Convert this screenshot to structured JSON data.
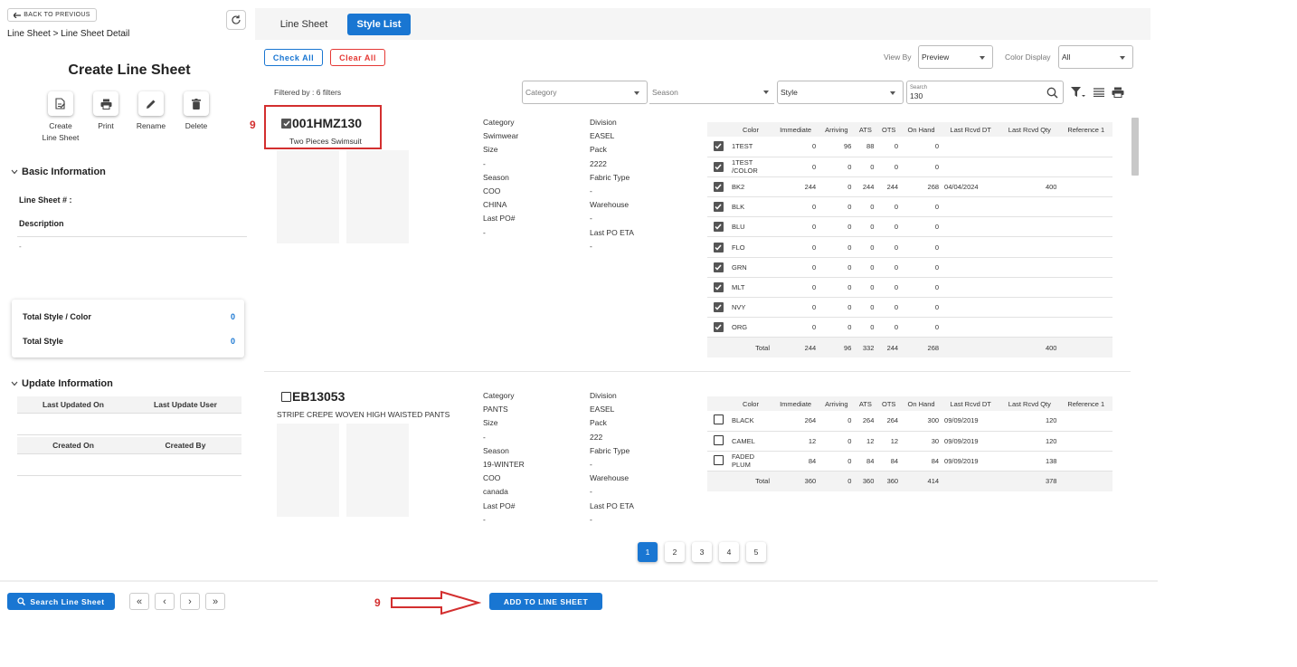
{
  "nav": {
    "back_label": "BACK TO PREVIOUS",
    "breadcrumb": "Line Sheet > Line Sheet Detail"
  },
  "page_title": "Create Line Sheet",
  "actions": [
    {
      "label_line1": "Create",
      "label_line2": "Line Sheet",
      "icon": "create-line-sheet-icon"
    },
    {
      "label_line1": "Print",
      "label_line2": "",
      "icon": "print-icon"
    },
    {
      "label_line1": "Rename",
      "label_line2": "",
      "icon": "pencil-icon"
    },
    {
      "label_line1": "Delete",
      "label_line2": "",
      "icon": "trash-icon"
    }
  ],
  "basic_info": {
    "heading": "Basic Information",
    "line_sheet_label": "Line Sheet # :",
    "description_label": "Description",
    "description_value": "-"
  },
  "totals": {
    "style_color_label": "Total Style / Color",
    "style_color_value": "0",
    "style_label": "Total Style",
    "style_value": "0"
  },
  "update_info": {
    "heading": "Update Information",
    "col1": "Last Updated On",
    "col2": "Last Update User",
    "col3": "Created On",
    "col4": "Created By"
  },
  "tabs": [
    {
      "label": "Line Sheet",
      "active": false
    },
    {
      "label": "Style List",
      "active": true
    }
  ],
  "toolbar": {
    "check_all": "Check All",
    "clear_all": "Clear All",
    "view_by_label": "View By",
    "view_by_value": "Preview",
    "color_display_label": "Color Display",
    "color_display_value": "All"
  },
  "filters": {
    "filtered_by": "Filtered by :  6 filters",
    "category": "Category",
    "season": "Season",
    "style": "Style",
    "search_label": "Search",
    "search_value": "130"
  },
  "headers": [
    "Color",
    "Immediate",
    "Arriving",
    "ATS",
    "OTS",
    "On Hand",
    "Last Rcvd DT",
    "Last Rcvd Qty",
    "Reference 1"
  ],
  "styles": [
    {
      "code": "001HMZ130",
      "checked": true,
      "desc": "Two Pieces Swimsuit",
      "attrs_left": [
        "Category",
        "Swimwear",
        "Size",
        "-",
        "Season",
        "COO",
        "CHINA",
        "Last PO#",
        "-"
      ],
      "attrs_right": [
        "Division",
        "EASEL",
        "Pack",
        "2222",
        "Fabric Type",
        "-",
        "Warehouse",
        "-",
        "Last PO ETA",
        "-"
      ],
      "rows": [
        {
          "color": "1TEST",
          "immediate": "0",
          "arriving": "96",
          "ats": "88",
          "ots": "0",
          "onhand": "0",
          "dt": "",
          "qty": "",
          "ref": "",
          "checked": true
        },
        {
          "color": "1TEST /COLOR",
          "immediate": "0",
          "arriving": "0",
          "ats": "0",
          "ots": "0",
          "onhand": "0",
          "dt": "",
          "qty": "",
          "ref": "",
          "checked": true
        },
        {
          "color": "BK2",
          "immediate": "244",
          "arriving": "0",
          "ats": "244",
          "ots": "244",
          "onhand": "268",
          "dt": "04/04/2024",
          "qty": "400",
          "ref": "",
          "checked": true
        },
        {
          "color": "BLK",
          "immediate": "0",
          "arriving": "0",
          "ats": "0",
          "ots": "0",
          "onhand": "0",
          "dt": "",
          "qty": "",
          "ref": "",
          "checked": true
        },
        {
          "color": "BLU",
          "immediate": "0",
          "arriving": "0",
          "ats": "0",
          "ots": "0",
          "onhand": "0",
          "dt": "",
          "qty": "",
          "ref": "",
          "checked": true
        },
        {
          "color": "FLO",
          "immediate": "0",
          "arriving": "0",
          "ats": "0",
          "ots": "0",
          "onhand": "0",
          "dt": "",
          "qty": "",
          "ref": "",
          "checked": true
        },
        {
          "color": "GRN",
          "immediate": "0",
          "arriving": "0",
          "ats": "0",
          "ots": "0",
          "onhand": "0",
          "dt": "",
          "qty": "",
          "ref": "",
          "checked": true
        },
        {
          "color": "MLT",
          "immediate": "0",
          "arriving": "0",
          "ats": "0",
          "ots": "0",
          "onhand": "0",
          "dt": "",
          "qty": "",
          "ref": "",
          "checked": true
        },
        {
          "color": "NVY",
          "immediate": "0",
          "arriving": "0",
          "ats": "0",
          "ots": "0",
          "onhand": "0",
          "dt": "",
          "qty": "",
          "ref": "",
          "checked": true
        },
        {
          "color": "ORG",
          "immediate": "0",
          "arriving": "0",
          "ats": "0",
          "ots": "0",
          "onhand": "0",
          "dt": "",
          "qty": "",
          "ref": "",
          "checked": true
        }
      ],
      "total": {
        "label": "Total",
        "immediate": "244",
        "arriving": "96",
        "ats": "332",
        "ots": "244",
        "onhand": "268",
        "dt": "",
        "qty": "400",
        "ref": ""
      }
    },
    {
      "code": "EB13053",
      "checked": false,
      "desc": "STRIPE CREPE WOVEN HIGH WAISTED PANTS",
      "attrs_left": [
        "Category",
        "PANTS",
        "Size",
        "-",
        "Season",
        "19-WINTER",
        "COO",
        "canada",
        "Last PO#",
        "-"
      ],
      "attrs_right": [
        "Division",
        "EASEL",
        "Pack",
        "222",
        "Fabric Type",
        "-",
        "Warehouse",
        "-",
        "Last PO ETA",
        "-"
      ],
      "rows": [
        {
          "color": "BLACK",
          "immediate": "264",
          "arriving": "0",
          "ats": "264",
          "ots": "264",
          "onhand": "300",
          "dt": "09/09/2019",
          "qty": "120",
          "ref": "",
          "checked": false
        },
        {
          "color": "CAMEL",
          "immediate": "12",
          "arriving": "0",
          "ats": "12",
          "ots": "12",
          "onhand": "30",
          "dt": "09/09/2019",
          "qty": "120",
          "ref": "",
          "checked": false
        },
        {
          "color": "FADED PLUM",
          "immediate": "84",
          "arriving": "0",
          "ats": "84",
          "ots": "84",
          "onhand": "84",
          "dt": "09/09/2019",
          "qty": "138",
          "ref": "",
          "checked": false
        }
      ],
      "total": {
        "label": "Total",
        "immediate": "360",
        "arriving": "0",
        "ats": "360",
        "ots": "360",
        "onhand": "414",
        "dt": "",
        "qty": "378",
        "ref": ""
      }
    }
  ],
  "pagination": [
    "1",
    "2",
    "3",
    "4",
    "5"
  ],
  "footer": {
    "search_button": "Search Line Sheet",
    "add_button": "ADD TO LINE SHEET"
  },
  "annotations": {
    "step1": "9",
    "step2": "9"
  },
  "colors": {
    "primary": "#1976d2",
    "annotation": "#d32f2f"
  }
}
